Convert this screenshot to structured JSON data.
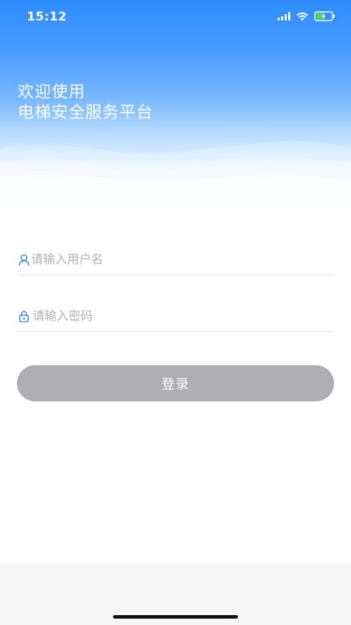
{
  "status_bar": {
    "time": "15:12"
  },
  "header": {
    "welcome_line1": "欢迎使用",
    "welcome_line2": "电梯安全服务平台"
  },
  "form": {
    "username": {
      "placeholder": "请输入用户名",
      "value": "",
      "icon": "user-icon"
    },
    "password": {
      "placeholder": "请输入密码",
      "value": "",
      "icon": "lock-icon"
    },
    "login_label": "登录"
  },
  "colors": {
    "header_blue": "#2d8cff",
    "icon_blue": "#3a8fe6",
    "button_disabled": "#aeaeb2",
    "battery_green": "#4cd964"
  }
}
